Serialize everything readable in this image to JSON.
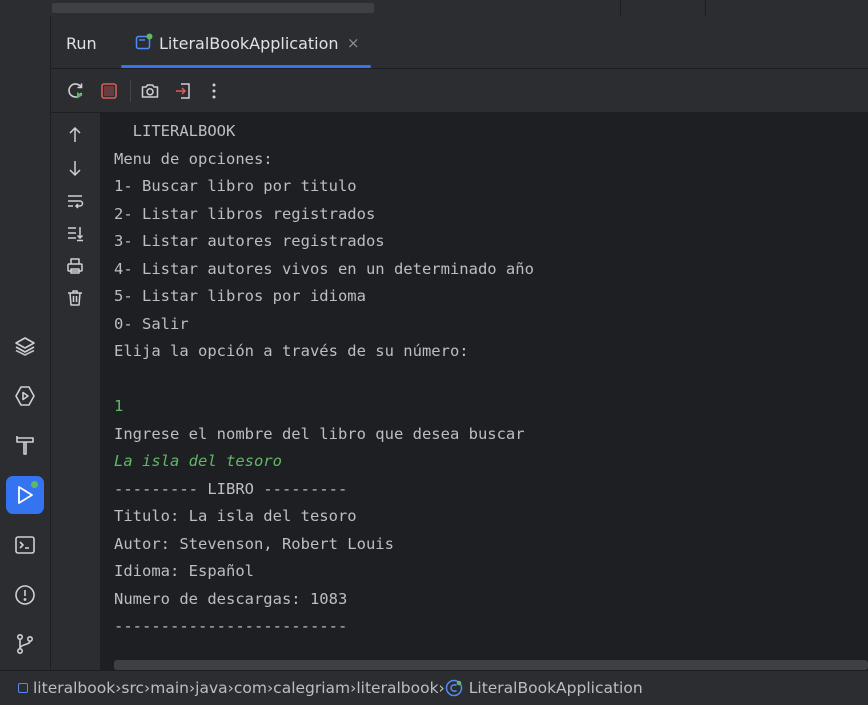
{
  "run_panel": {
    "title": "Run",
    "tab": {
      "label": "LiteralBookApplication",
      "close": "×"
    }
  },
  "console": {
    "lines": [
      {
        "text": "  LITERALBOOK",
        "kind": "output"
      },
      {
        "text": "Menu de opciones:",
        "kind": "output"
      },
      {
        "text": "1- Buscar libro por titulo",
        "kind": "output"
      },
      {
        "text": "2- Listar libros registrados",
        "kind": "output"
      },
      {
        "text": "3- Listar autores registrados",
        "kind": "output"
      },
      {
        "text": "4- Listar autores vivos en un determinado año",
        "kind": "output"
      },
      {
        "text": "5- Listar libros por idioma",
        "kind": "output"
      },
      {
        "text": "0- Salir",
        "kind": "output"
      },
      {
        "text": "Elija la opción a través de su número:",
        "kind": "output"
      },
      {
        "text": "",
        "kind": "output"
      },
      {
        "text": "1",
        "kind": "input"
      },
      {
        "text": "Ingrese el nombre del libro que desea buscar",
        "kind": "output"
      },
      {
        "text": "La isla del tesoro",
        "kind": "input-italic"
      },
      {
        "text": "--------- LIBRO ---------",
        "kind": "output"
      },
      {
        "text": "Titulo: La isla del tesoro",
        "kind": "output"
      },
      {
        "text": "Autor: Stevenson, Robert Louis",
        "kind": "output"
      },
      {
        "text": "Idioma: Español",
        "kind": "output"
      },
      {
        "text": "Numero de descargas: 1083",
        "kind": "output"
      },
      {
        "text": "-------------------------",
        "kind": "output"
      }
    ]
  },
  "breadcrumb": [
    {
      "label": "literalbook",
      "icon": "module-icon"
    },
    {
      "label": "src"
    },
    {
      "label": "main"
    },
    {
      "label": "java"
    },
    {
      "label": "com"
    },
    {
      "label": "calegriam"
    },
    {
      "label": "literalbook"
    },
    {
      "label": "LiteralBookApplication",
      "icon": "spring-class-icon"
    }
  ],
  "colors": {
    "accent": "#3574f0",
    "running_dot": "#5fb865",
    "console_bg": "#1e1f22",
    "panel_bg": "#2b2d30",
    "input_text": "#5fb865",
    "stop": "#db5c5c"
  }
}
